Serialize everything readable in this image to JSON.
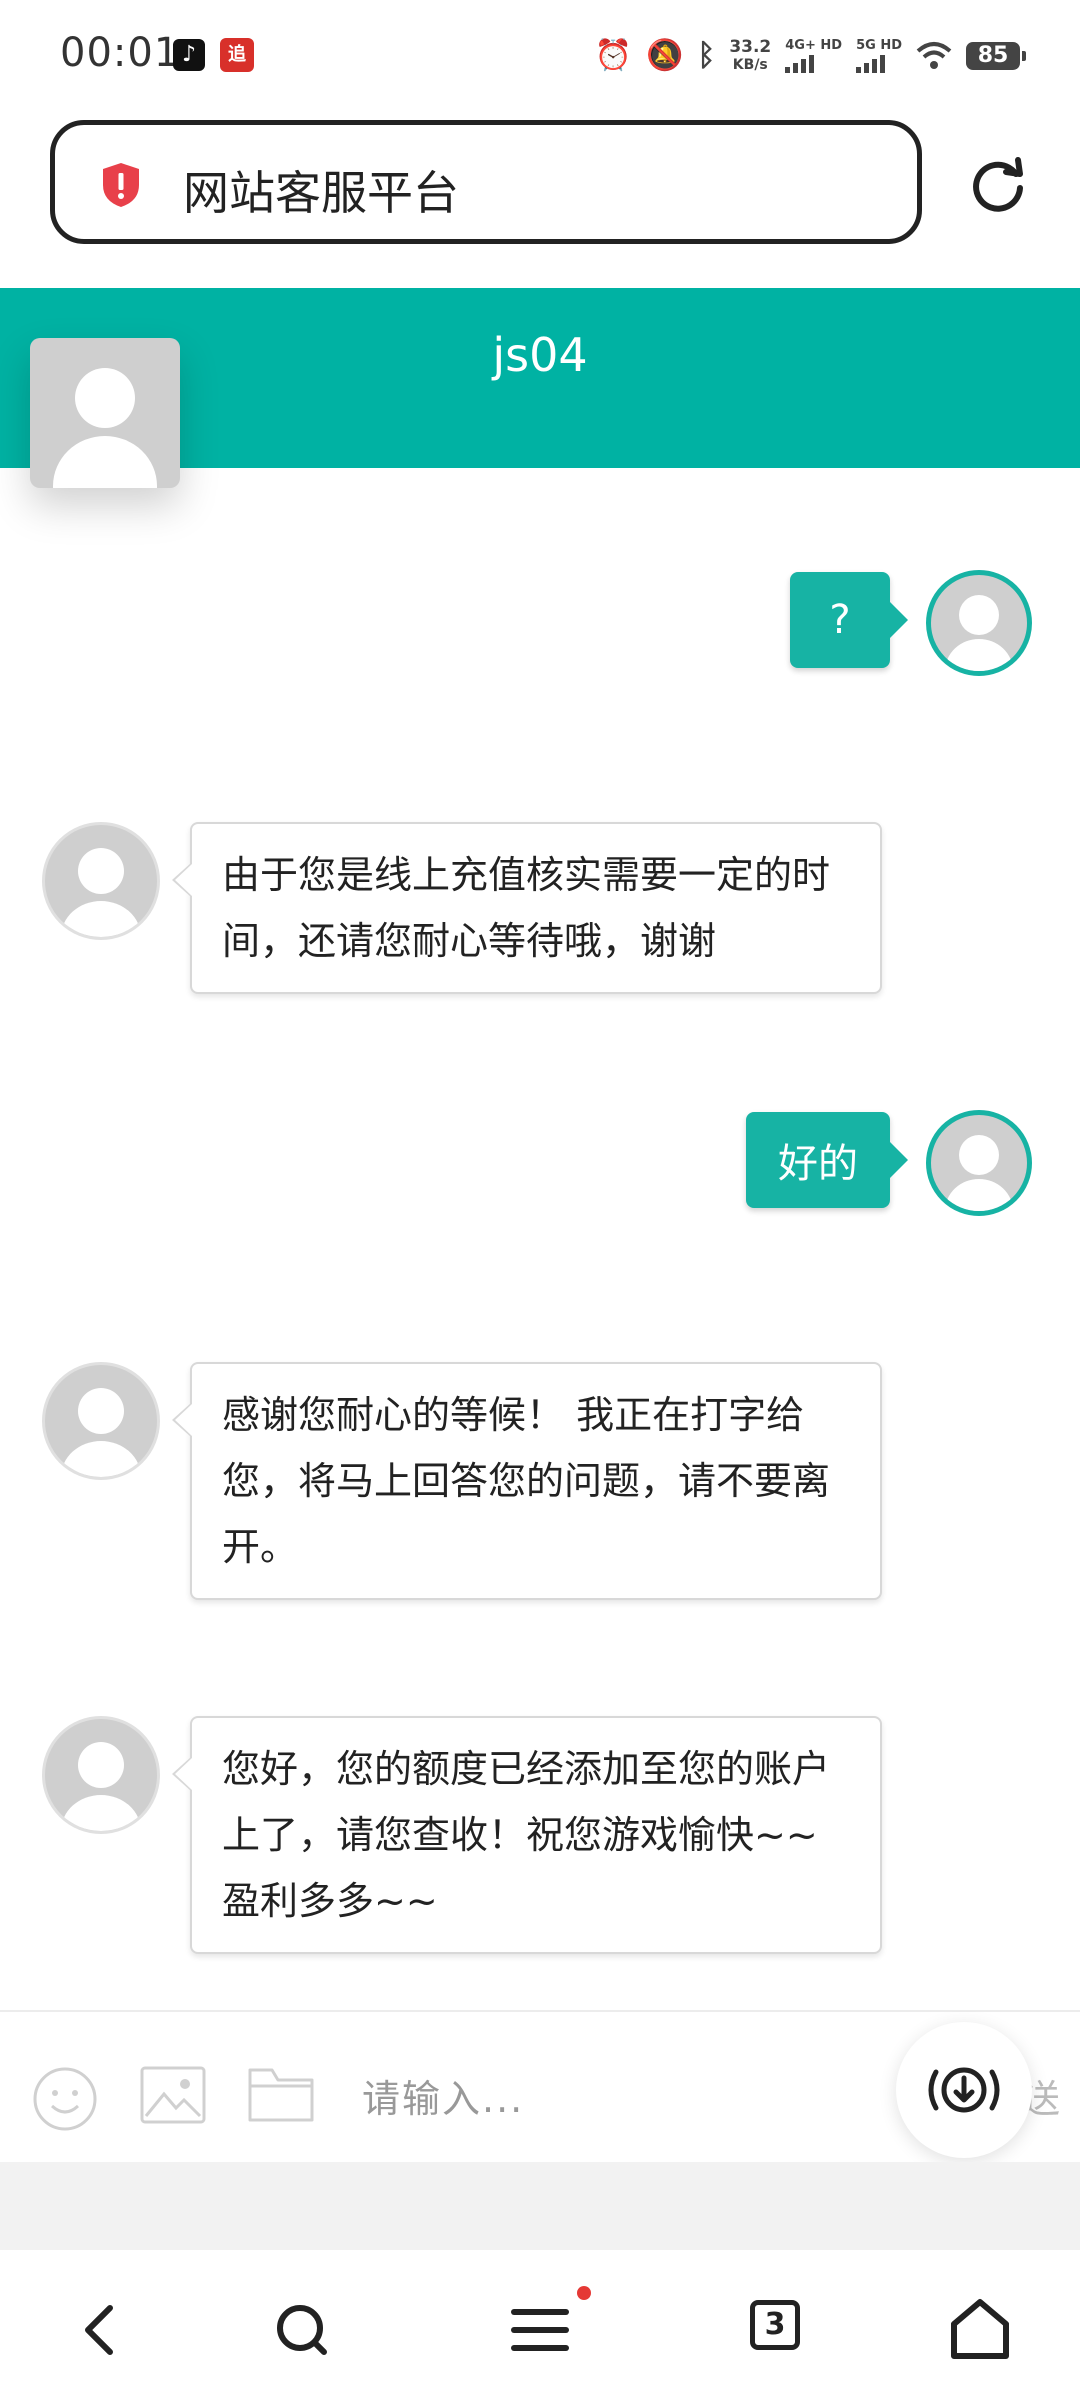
{
  "status_bar": {
    "time": "00:01",
    "app_icons": [
      "tiktok-icon",
      "app-notification-icon"
    ],
    "app2_glyph": "追",
    "net_speed_value": "33.2",
    "net_speed_unit": "KB/s",
    "sim1": "4G+ HD",
    "sim2": "5G HD",
    "battery": "85"
  },
  "address_bar": {
    "title": "网站客服平台"
  },
  "chat": {
    "agent_name": "js04",
    "accent_color": "#00b2a3",
    "messages": [
      {
        "from": "me",
        "text": "?"
      },
      {
        "from": "agent",
        "text": "由于您是线上充值核实需要一定的时间，还请您耐心等待哦，谢谢"
      },
      {
        "from": "me",
        "text": "好的"
      },
      {
        "from": "agent",
        "text": "感谢您耐心的等候！ 我正在打字给您，将马上回答您的问题，请不要离开。"
      },
      {
        "from": "agent",
        "text": "您好，您的额度已经添加至您的账户上了，请您查收！祝您游戏愉快~~盈利多多~~"
      }
    ]
  },
  "input_bar": {
    "placeholder": "请输入...",
    "send_label": "送"
  },
  "bottom_nav": {
    "tab_count": "3"
  }
}
